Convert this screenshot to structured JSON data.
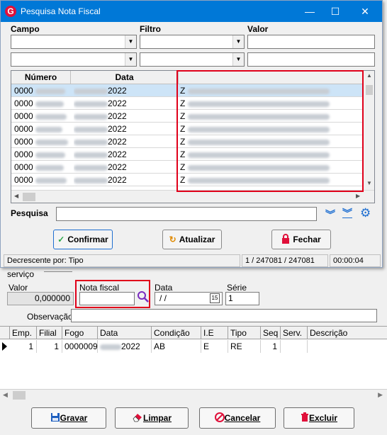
{
  "window": {
    "title": "Pesquisa Nota Fiscal"
  },
  "filters": {
    "campo_label": "Campo",
    "filtro_label": "Filtro",
    "valor_label": "Valor"
  },
  "grid": {
    "columns": [
      "Número",
      "Data"
    ],
    "rows": [
      {
        "numero": "0000",
        "data": "2022",
        "desc": "Z"
      },
      {
        "numero": "0000",
        "data": "2022",
        "desc": "Z"
      },
      {
        "numero": "0000",
        "data": "2022",
        "desc": "Z"
      },
      {
        "numero": "0000",
        "data": "2022",
        "desc": "Z"
      },
      {
        "numero": "0000",
        "data": "2022",
        "desc": "Z"
      },
      {
        "numero": "0000",
        "data": "2022",
        "desc": "Z"
      },
      {
        "numero": "0000",
        "data": "2022",
        "desc": "Z"
      },
      {
        "numero": "0000",
        "data": "2022",
        "desc": "Z"
      }
    ]
  },
  "search": {
    "label": "Pesquisa",
    "value": ""
  },
  "buttons": {
    "confirmar": "Confirmar",
    "atualizar": "Atualizar",
    "fechar": "Fechar"
  },
  "status": {
    "sort": "Decrescente por: Tipo",
    "records": "1 / 247081 / 247081",
    "time": "00:00:04"
  },
  "form": {
    "servico_label": "serviço",
    "valor_label": "Valor",
    "valor_value": "0,000000",
    "nota_label": "Nota fiscal",
    "nota_value": "",
    "data_label": "Data",
    "data_value": " /  /",
    "serie_label": "Série",
    "serie_value": "1",
    "obs_label": "Observação"
  },
  "lower_grid": {
    "columns": [
      "Emp.",
      "Filial",
      "Fogo",
      "Data",
      "Condição",
      "I.E",
      "Tipo",
      "Seq",
      "Serv.",
      "Descrição"
    ],
    "row": {
      "emp": "1",
      "filial": "1",
      "fogo": "0000009",
      "data": "2022",
      "condicao": "AB",
      "ie": "E",
      "tipo": "RE",
      "seq": "1",
      "serv": "",
      "descricao": ""
    }
  },
  "actions": {
    "gravar": "Gravar",
    "limpar": "Limpar",
    "cancelar": "Cancelar",
    "excluir": "Excluir"
  },
  "colors": {
    "titlebar": "#0078d7",
    "highlight": "#e0001a",
    "selection": "#cde4f7"
  },
  "icons": [
    "app-logo-icon",
    "minimize-icon",
    "maximize-icon",
    "close-icon",
    "chevron-down-icon",
    "double-chevron-down-icon",
    "gear-icon",
    "check-icon",
    "refresh-icon",
    "lock-icon",
    "search-icon",
    "calendar-icon",
    "save-icon",
    "eraser-icon",
    "cancel-icon",
    "trash-icon"
  ]
}
